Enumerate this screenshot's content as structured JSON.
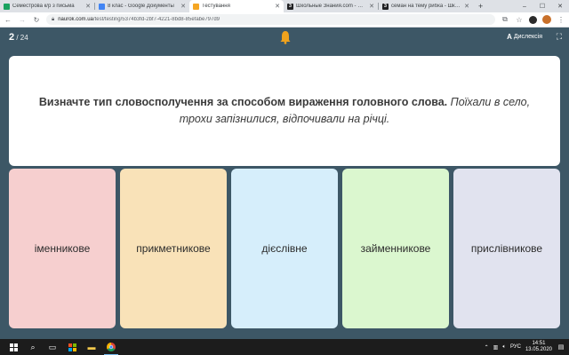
{
  "browser": {
    "tabs": [
      {
        "title": "Семестрова к/р з письма",
        "active": false,
        "favicon_color": "#1aa260"
      },
      {
        "title": "8 клас - Google Документы",
        "active": false,
        "favicon_color": "#4285f4"
      },
      {
        "title": "Тестування",
        "active": true,
        "favicon_color": "#f5a623"
      },
      {
        "title": "Школьные Знания.com - Вирш",
        "active": false,
        "favicon_color": "#202124"
      },
      {
        "title": "семан на тему рибка - Школьн",
        "active": false,
        "favicon_color": "#202124"
      }
    ],
    "new_tab_label": "+",
    "window_controls": {
      "minimize": "–",
      "maximize": "☐",
      "close": "✕"
    },
    "address": {
      "host": "naurok.com.ua",
      "path": "/test/testing/5374b3fd-2bf7-4221-8bd8-85efabe797d9"
    }
  },
  "app": {
    "counter": {
      "current": "2",
      "total": " / 24"
    },
    "dyslexia_label": "Дислексія",
    "dyslexia_icon_text": "A"
  },
  "question": {
    "bold_text": "Визначте тип словосполучення за способом вираження головного слова.",
    "italic_text": "Поїхали в село, трохи запізнилися, відпочивали на річці."
  },
  "answers": [
    {
      "label": "іменникове",
      "color": "#f6cfcf"
    },
    {
      "label": "прикметникове",
      "color": "#f9e2b8"
    },
    {
      "label": "дієслівне",
      "color": "#d6eefb"
    },
    {
      "label": "займенникове",
      "color": "#dbf7cf"
    },
    {
      "label": "прислівникове",
      "color": "#e1e3ef"
    }
  ],
  "taskbar": {
    "language": "РУС",
    "time": "14:51",
    "date": "13.05.2020"
  },
  "colors": {
    "header_bg": "#3d5766",
    "accent_bell": "#f0a21c"
  }
}
